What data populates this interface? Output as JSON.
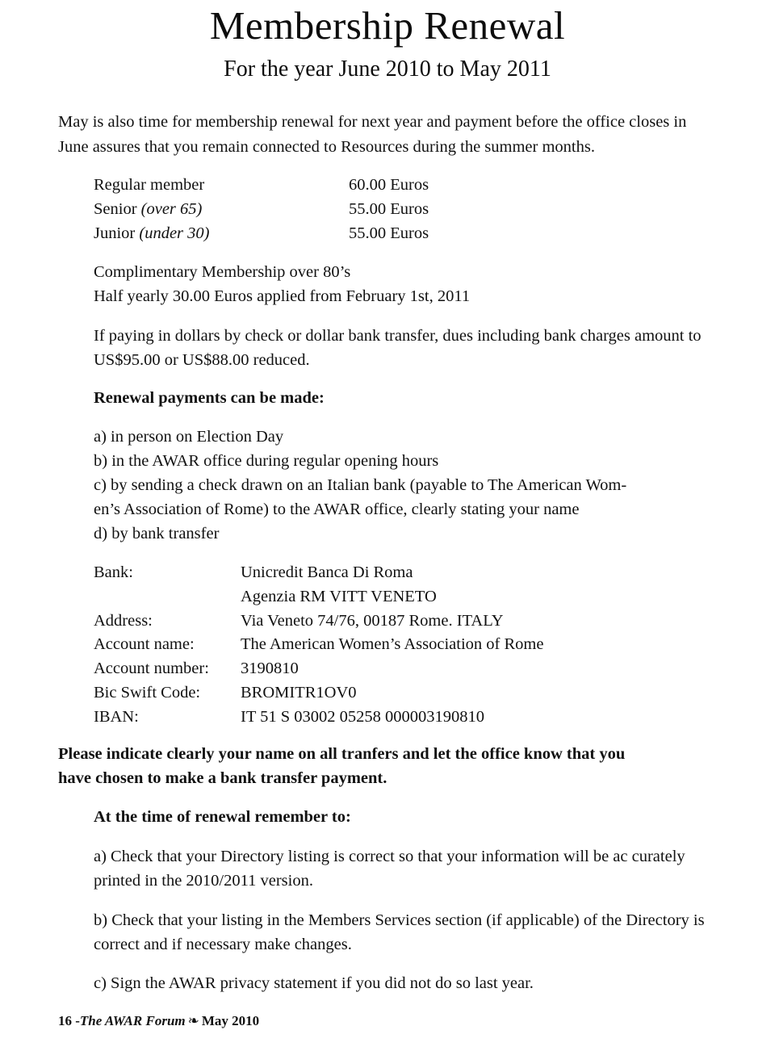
{
  "document": {
    "title": "Membership Renewal",
    "subtitle": "For the year June 2010 to May 2011",
    "intro": "May is also time for membership renewal for next year and payment before the office closes in June assures that you remain connected to Resources during the summer months.",
    "fees": [
      {
        "type": "Regular member",
        "qualifier": "",
        "amount": "60.00 Euros"
      },
      {
        "type": "Senior ",
        "qualifier": "(over 65)",
        "amount": "55.00 Euros"
      },
      {
        "type": "Junior ",
        "qualifier": "(under 30)",
        "amount": "55.00 Euros"
      }
    ],
    "complimentary_line_1": "Complimentary Membership over 80’s",
    "complimentary_line_2": "Half yearly 30.00 Euros applied from February 1st, 2011",
    "dollar_paragraph": "If paying in dollars by check or dollar bank transfer, dues including bank charges amount to US$95.00 or US$88.00 reduced.",
    "payments_heading": "Renewal payments can be made:",
    "payment_options": [
      "a) in person on Election Day",
      "b) in the AWAR office during regular opening hours",
      "c) by sending a check drawn on an Italian bank (payable to The American Wom-",
      "en’s Association of Rome) to the AWAR office, clearly stating your name",
      "d) by bank transfer"
    ],
    "bank_details": [
      {
        "key": "Bank:",
        "value": "Unicredit Banca Di Roma"
      },
      {
        "key": "",
        "value": "Agenzia RM VITT VENETO"
      },
      {
        "key": "Address:",
        "value": "Via Veneto 74/76, 00187 Rome. ITALY"
      },
      {
        "key": "Account name:",
        "value": "The American Women’s Association of Rome"
      },
      {
        "key": "Account number:",
        "value": "3190810"
      },
      {
        "key": "Bic Swift Code:",
        "value": "BROMITR1OV0"
      },
      {
        "key": "IBAN:",
        "value": "IT 51 S 03002 05258 000003190810"
      }
    ],
    "notice_line_1": "Please indicate clearly your name on all tranfers and let the office know that you",
    "notice_line_2": "have chosen to make a bank transfer payment.",
    "remember_heading": "At the time of renewal remember to:",
    "remember_items": [
      "a) Check that your Directory listing is correct so that your information will be ac curately printed in the 2010/2011 version.",
      "b) Check that your listing in the Members Services section (if applicable) of the Directory is correct and if necessary make changes.",
      "c) Sign the AWAR privacy statement if you did not do so last year."
    ],
    "footer": {
      "page_number": "16 -",
      "publication": "The AWAR Forum",
      "ornament": "❧",
      "date": "May 2010"
    }
  }
}
